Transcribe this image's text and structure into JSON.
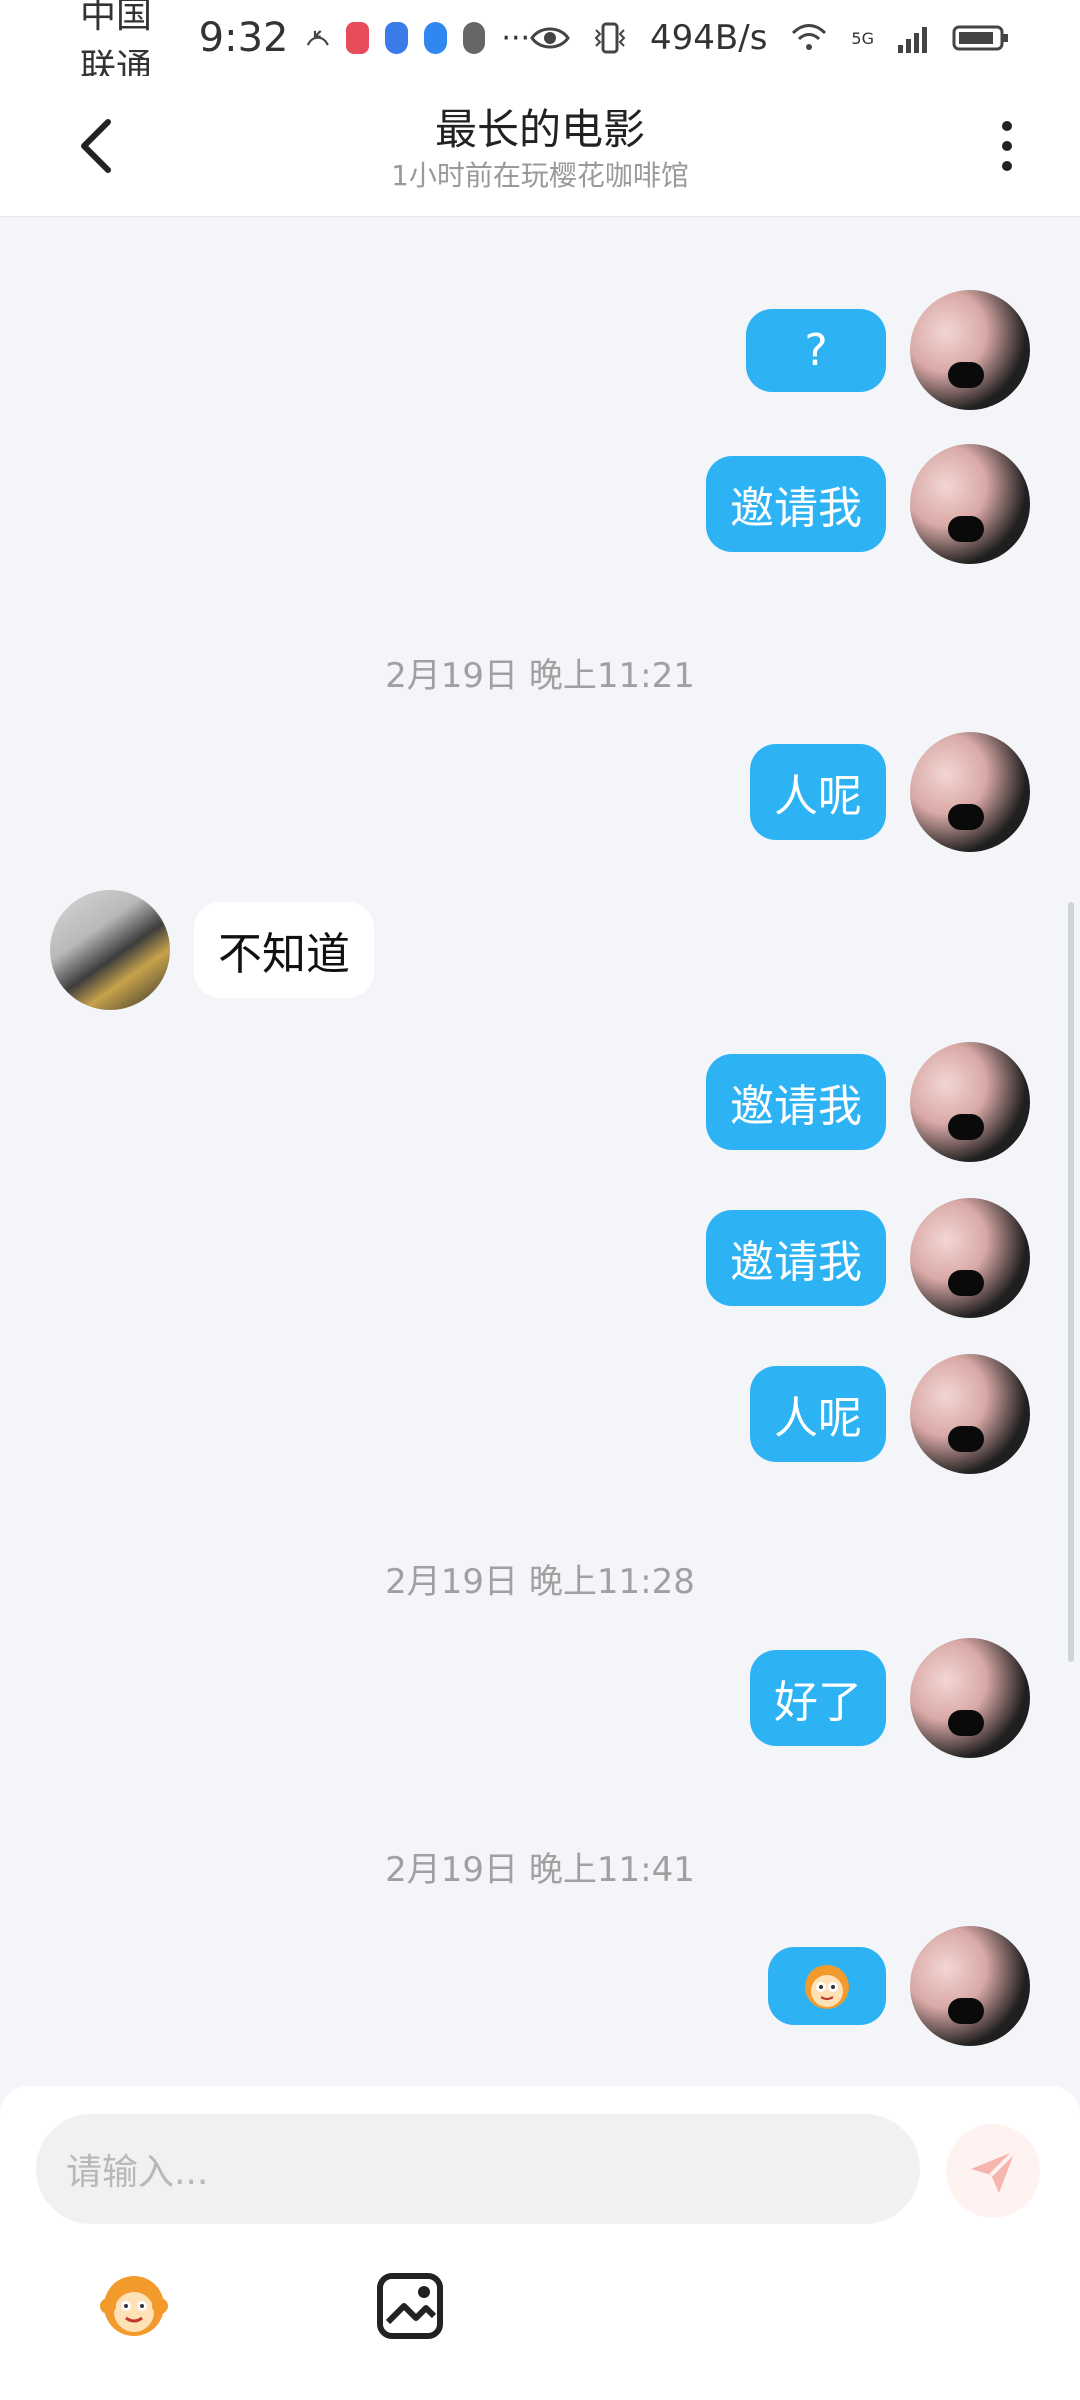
{
  "status_bar": {
    "carrier": "中国联通",
    "time": "9:32",
    "speed": "494B/s",
    "network": "5G",
    "ellipsis": "···",
    "icons": [
      "missed-call-icon",
      "app-badge-icon",
      "shield-icon",
      "browser-icon",
      "wechat-icon",
      "eye-icon",
      "vibrate-icon",
      "wifi-icon",
      "signal-icon",
      "battery-icon"
    ]
  },
  "header": {
    "title": "最长的电影",
    "subtitle": "1小时前在玩樱花咖啡馆",
    "icons": [
      "back-icon",
      "more-icon"
    ]
  },
  "chat": {
    "messages": [
      {
        "side": "out",
        "text": "?"
      },
      {
        "side": "out",
        "text": "邀请我"
      },
      {
        "timestamp": "2月19日 晚上11:21"
      },
      {
        "side": "out",
        "text": "人呢"
      },
      {
        "side": "in",
        "text": "不知道"
      },
      {
        "side": "out",
        "text": "邀请我"
      },
      {
        "side": "out",
        "text": "邀请我"
      },
      {
        "side": "out",
        "text": "人呢"
      },
      {
        "timestamp": "2月19日 晚上11:28"
      },
      {
        "side": "out",
        "text": "好了"
      },
      {
        "timestamp": "2月19日 晚上11:41"
      },
      {
        "side": "out",
        "sticker": "monkey-face-sticker"
      }
    ]
  },
  "input": {
    "placeholder": "请输入..."
  },
  "toolbar": {
    "icons": [
      "emoji-monkey-icon",
      "image-icon"
    ]
  },
  "colors": {
    "out_bubble": "#2db2f4",
    "in_bubble": "#ffffff",
    "background": "#f3f5f8",
    "send_button_bg": "#fff3f2",
    "send_icon": "#f7b5b0"
  }
}
